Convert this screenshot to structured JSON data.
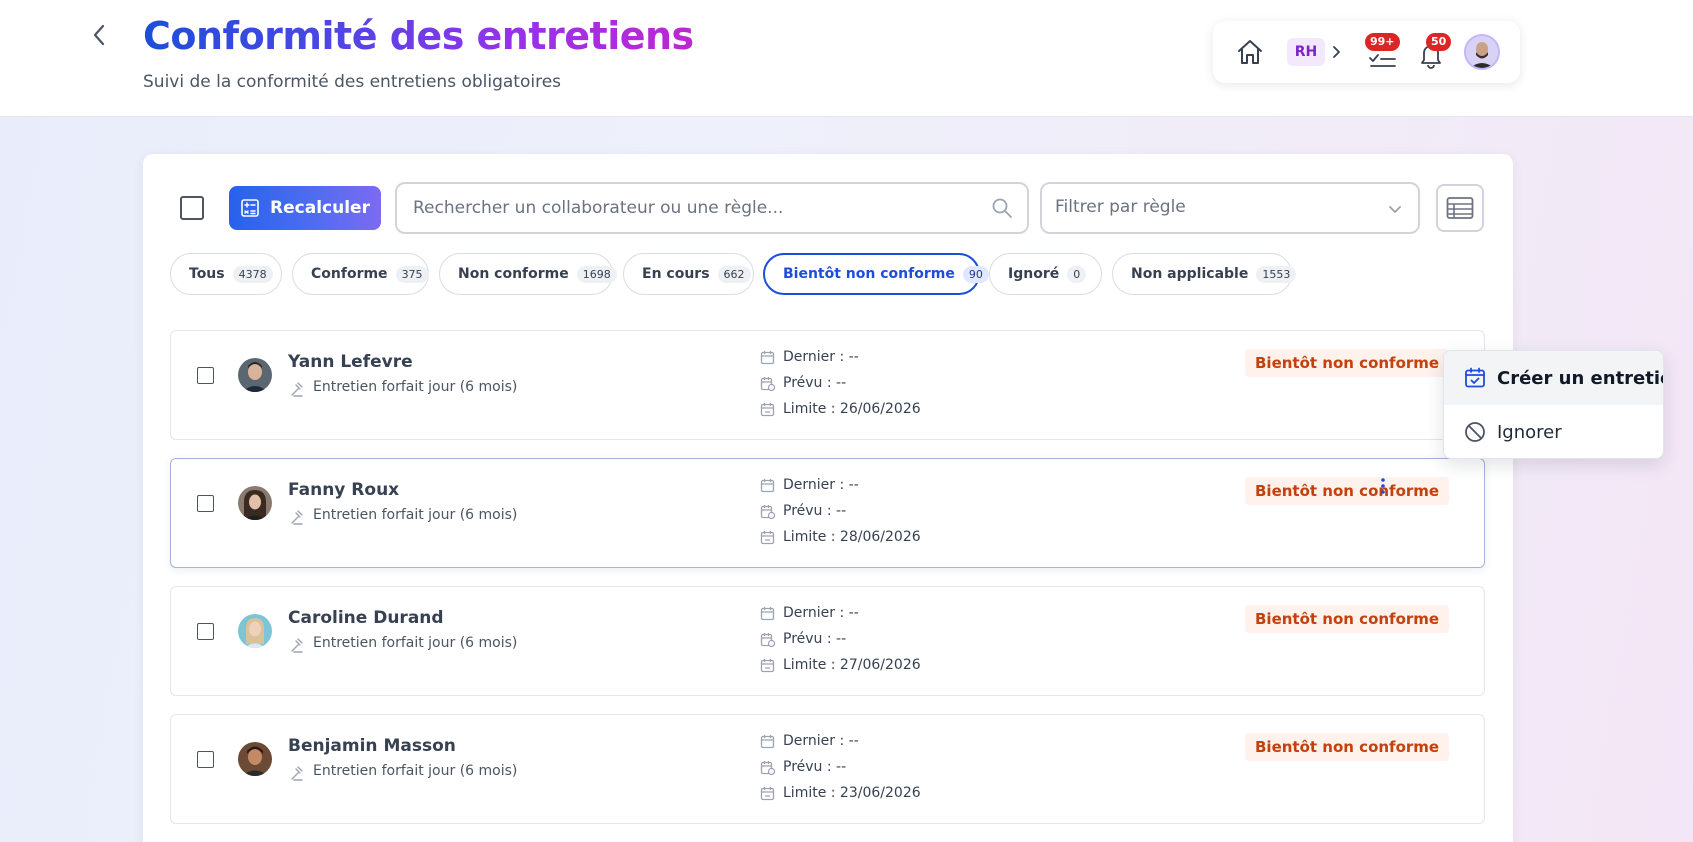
{
  "header": {
    "title": "Conformité des entretiens",
    "subtitle": "Suivi de la conformité des entretiens obligatoires"
  },
  "topnav": {
    "section_label": "RH",
    "tasks_badge": "99+",
    "notifications_badge": "50"
  },
  "toolbar": {
    "recalc_label": "Recalculer",
    "search_placeholder": "Rechercher un collaborateur ou une règle...",
    "filter_placeholder": "Filtrer par règle"
  },
  "tabs": [
    {
      "label": "Tous",
      "count": "4378"
    },
    {
      "label": "Conforme",
      "count": "375"
    },
    {
      "label": "Non conforme",
      "count": "1698"
    },
    {
      "label": "En cours",
      "count": "662"
    },
    {
      "label": "Bientôt non conforme",
      "count": "90",
      "active": true
    },
    {
      "label": "Ignoré",
      "count": "0"
    },
    {
      "label": "Non applicable",
      "count": "1553"
    }
  ],
  "rows": [
    {
      "name": "Yann Lefevre",
      "rule": "Entretien forfait jour (6 mois)",
      "dernier": "Dernier : --",
      "prevu": "Prévu : --",
      "limite": "Limite : 26/06/2026",
      "status": "Bientôt non conforme"
    },
    {
      "name": "Fanny Roux",
      "rule": "Entretien forfait jour (6 mois)",
      "dernier": "Dernier : --",
      "prevu": "Prévu : --",
      "limite": "Limite : 28/06/2026",
      "status": "Bientôt non conforme"
    },
    {
      "name": "Caroline Durand",
      "rule": "Entretien forfait jour (6 mois)",
      "dernier": "Dernier : --",
      "prevu": "Prévu : --",
      "limite": "Limite : 27/06/2026",
      "status": "Bientôt non conforme"
    },
    {
      "name": "Benjamin Masson",
      "rule": "Entretien forfait jour (6 mois)",
      "dernier": "Dernier : --",
      "prevu": "Prévu : --",
      "limite": "Limite : 23/06/2026",
      "status": "Bientôt non conforme"
    }
  ],
  "context_menu": {
    "create_label": "Créer un entretien",
    "ignore_label": "Ignorer"
  },
  "colors": {
    "accent": "#2563eb",
    "status_warning_bg": "#fff1ec",
    "status_warning_text": "#c2410c",
    "badge_red": "#dc2626"
  }
}
